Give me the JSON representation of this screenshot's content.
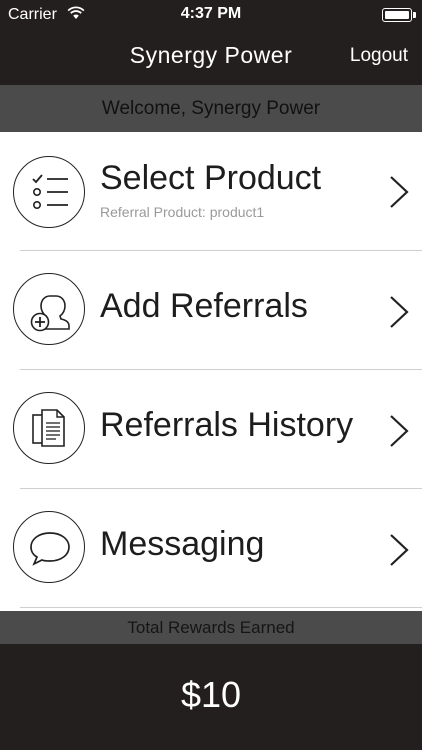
{
  "status_bar": {
    "carrier": "Carrier",
    "time": "4:37 PM"
  },
  "nav": {
    "title": "Synergy Power",
    "logout_label": "Logout"
  },
  "welcome_text": "Welcome, Synergy Power",
  "menu": {
    "items": [
      {
        "title": "Select Product",
        "subtitle": "Referral Product: product1",
        "icon": "checklist-icon"
      },
      {
        "title": "Add Referrals",
        "icon": "add-person-icon"
      },
      {
        "title": "Referrals History",
        "icon": "documents-icon"
      },
      {
        "title": "Messaging",
        "icon": "chat-bubble-icon"
      }
    ]
  },
  "rewards": {
    "label": "Total Rewards Earned",
    "value": "$10"
  },
  "colors": {
    "bar_dark": "#231f1e",
    "bar_gray": "#4b4b4b",
    "text_dark": "#1d1d1d",
    "subtitle_gray": "#9a9a9a"
  }
}
